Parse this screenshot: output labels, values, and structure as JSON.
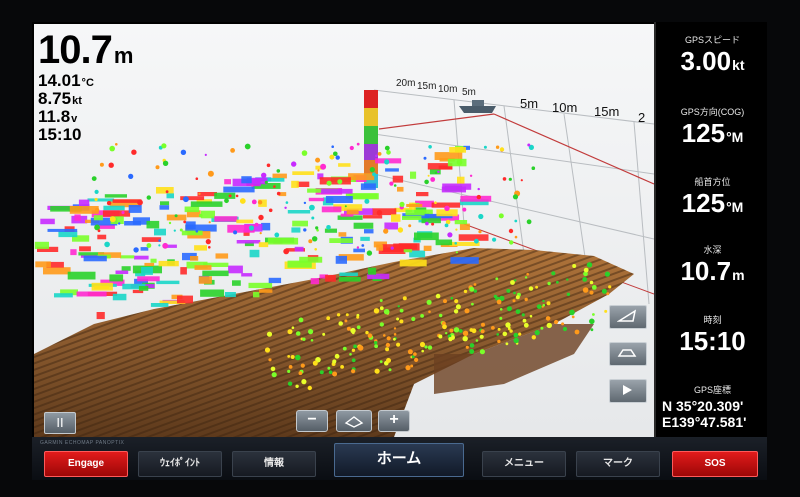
{
  "readouts": {
    "depth": {
      "value": "10.7",
      "unit": "m"
    },
    "water_temp": {
      "value": "14.01",
      "unit": "°C"
    },
    "speed": {
      "value": "8.75",
      "unit": "kt"
    },
    "voltage": {
      "value": "11.8",
      "unit": "v"
    },
    "time": "15:10"
  },
  "range_scale": {
    "back": [
      "20m",
      "15m",
      "10m",
      "5m"
    ],
    "front": [
      "5m",
      "10m",
      "15m",
      "2"
    ]
  },
  "panel": {
    "gps_speed": {
      "label": "GPSスピード",
      "value": "3.00",
      "unit": "kt"
    },
    "gps_cog": {
      "label": "GPS方向(COG)",
      "value": "125",
      "unit": "°M"
    },
    "heading": {
      "label": "船首方位",
      "value": "125",
      "unit": "°M"
    },
    "water_depth": {
      "label": "水深",
      "value": "10.7",
      "unit": "m"
    },
    "clock": {
      "label": "時刻",
      "value": "15:10"
    },
    "gps_position": {
      "label": "GPS座標",
      "lat": "N  35°20.309'",
      "lon": "E139°47.581'"
    }
  },
  "controls": {
    "pause": "II",
    "zoom_minus": "−",
    "zoom_plus": "+"
  },
  "bottom_bar": {
    "tiny_text": "GARMIN ECHOMAP PANOPTIX",
    "tabs": [
      {
        "label": "Engage"
      },
      {
        "label": "ｳｪｲﾎﾟｲﾝﾄ"
      },
      {
        "label": "情報"
      },
      {
        "label": "ホーム"
      },
      {
        "label": "メニュー"
      },
      {
        "label": "マーク"
      },
      {
        "label": "SOS"
      }
    ]
  },
  "colors": {
    "engage_red": "#e21b1b",
    "sos_red": "#e21b1b",
    "seabed": "#8a5a2e",
    "background": "#f2f3f4"
  },
  "icons": [
    "pause-icon",
    "zoom-out-icon",
    "layers-icon",
    "zoom-in-icon",
    "view-perspective-icon",
    "view-side-icon",
    "play-icon",
    "boat-icon"
  ]
}
